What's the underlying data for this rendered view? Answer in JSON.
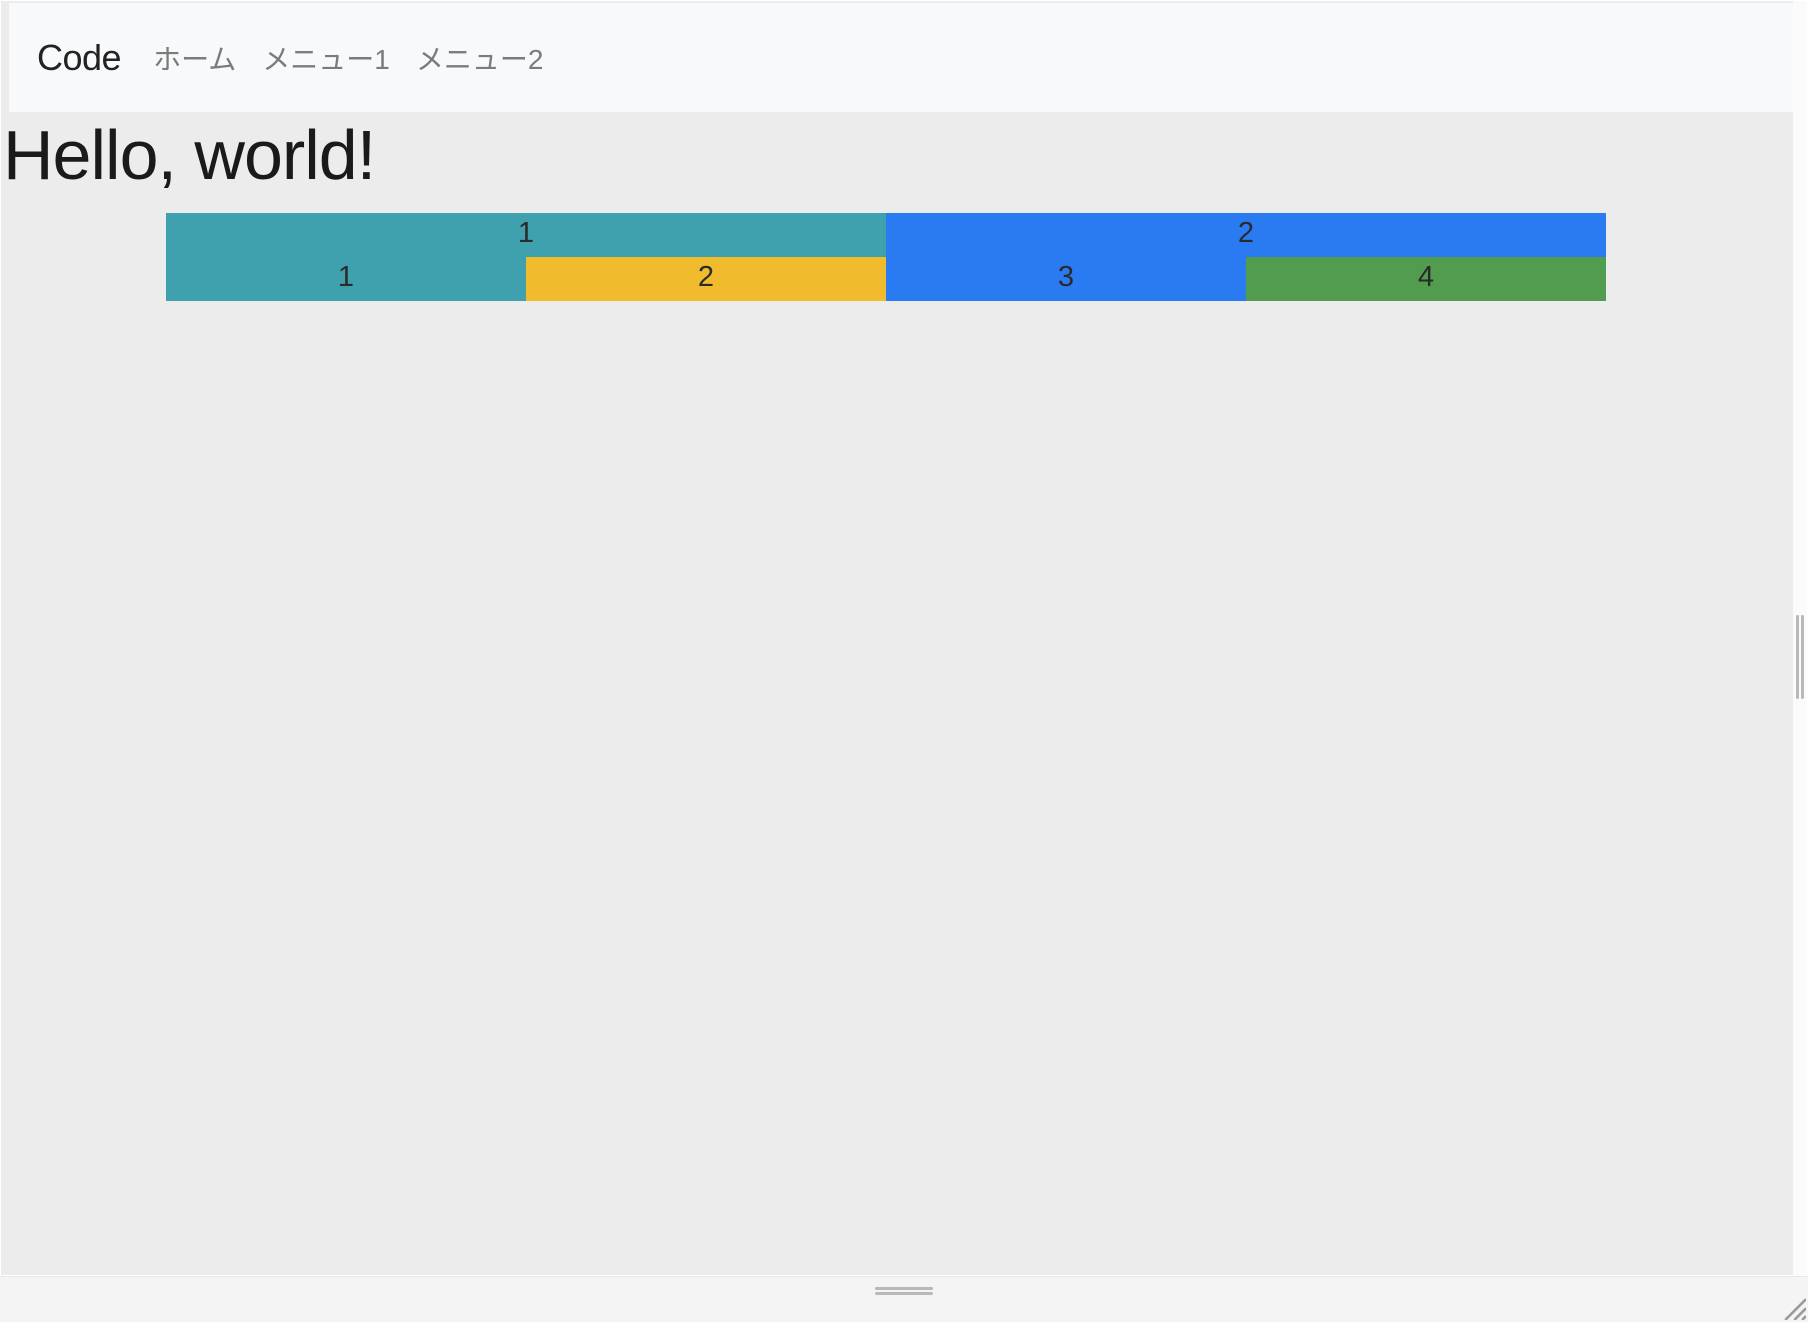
{
  "navbar": {
    "brand": "Code",
    "links": [
      "ホーム",
      "メニュー1",
      "メニュー2"
    ]
  },
  "heading": "Hello, world!",
  "grid": {
    "row1": [
      {
        "label": "1",
        "color": "teal",
        "span": "w6"
      },
      {
        "label": "2",
        "color": "blue",
        "span": "w6"
      }
    ],
    "row2": [
      {
        "label": "1",
        "color": "teal",
        "span": "w3"
      },
      {
        "label": "2",
        "color": "yellow",
        "span": "w3"
      },
      {
        "label": "3",
        "color": "blue",
        "span": "w3"
      },
      {
        "label": "4",
        "color": "green",
        "span": "w3"
      }
    ]
  },
  "colors": {
    "teal": "#3fa0ae",
    "blue": "#2a7af1",
    "yellow": "#f1bb2e",
    "green": "#529c4f"
  }
}
